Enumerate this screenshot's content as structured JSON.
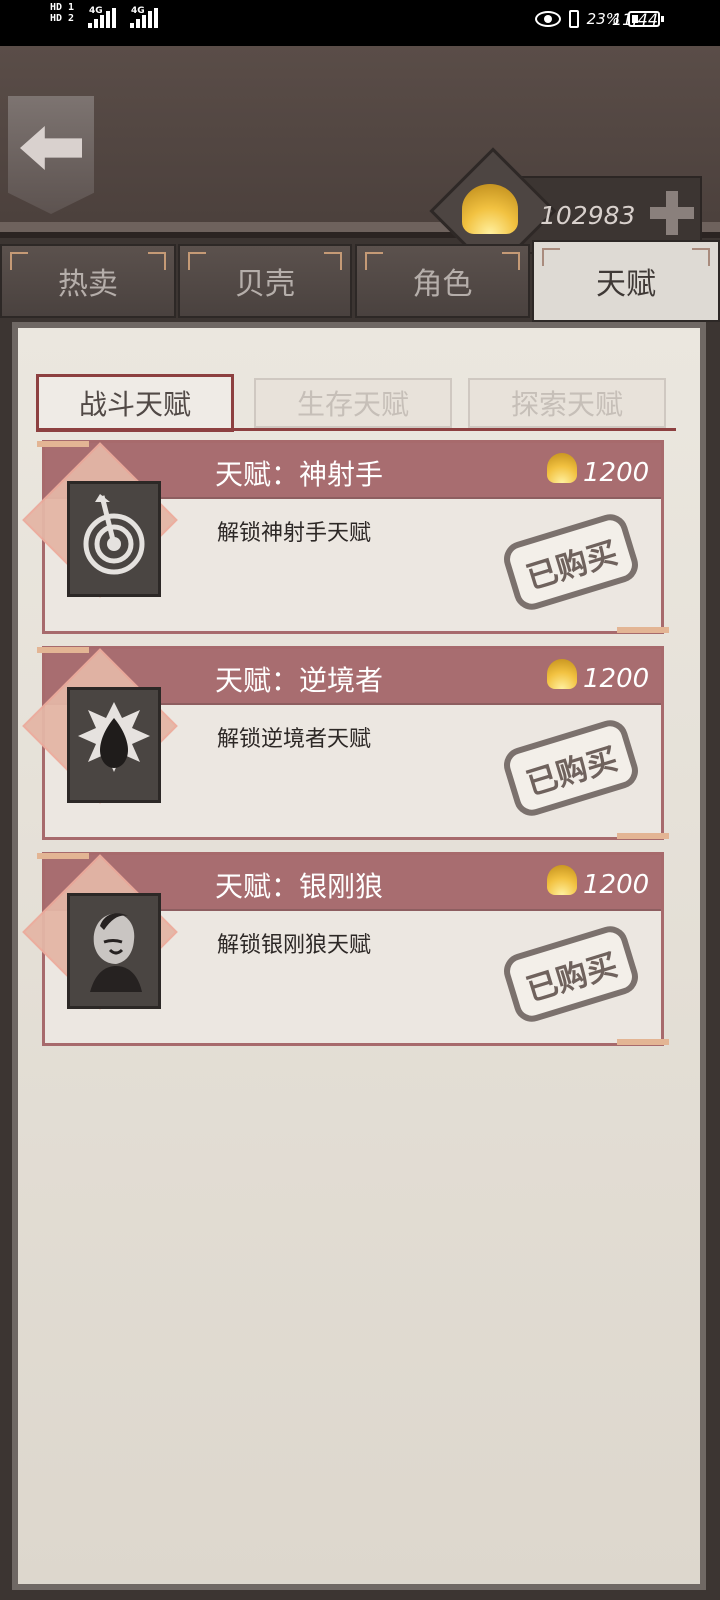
{
  "status": {
    "left_top": "HD 1",
    "left_bottom": "HD 2",
    "network1": "4G",
    "network2": "4G",
    "battery_pct": 23,
    "battery_label": "23%",
    "time": "11:44"
  },
  "header": {
    "currency_amount": "102983"
  },
  "tabs": [
    {
      "label": "热卖"
    },
    {
      "label": "贝壳"
    },
    {
      "label": "角色"
    },
    {
      "label": "天赋"
    }
  ],
  "subtabs": [
    {
      "label": "战斗天赋"
    },
    {
      "label": "生存天赋"
    },
    {
      "label": "探索天赋"
    }
  ],
  "cards": [
    {
      "title": "天赋：神射手",
      "price": "1200",
      "description": "解锁神射手天赋",
      "badge": "已购买",
      "icon": "target-arrow-icon"
    },
    {
      "title": "天赋：逆境者",
      "price": "1200",
      "description": "解锁逆境者天赋",
      "badge": "已购买",
      "icon": "droplet-burst-icon"
    },
    {
      "title": "天赋：银刚狼",
      "price": "1200",
      "description": "解锁银刚狼天赋",
      "badge": "已购买",
      "icon": "portrait-icon"
    }
  ]
}
